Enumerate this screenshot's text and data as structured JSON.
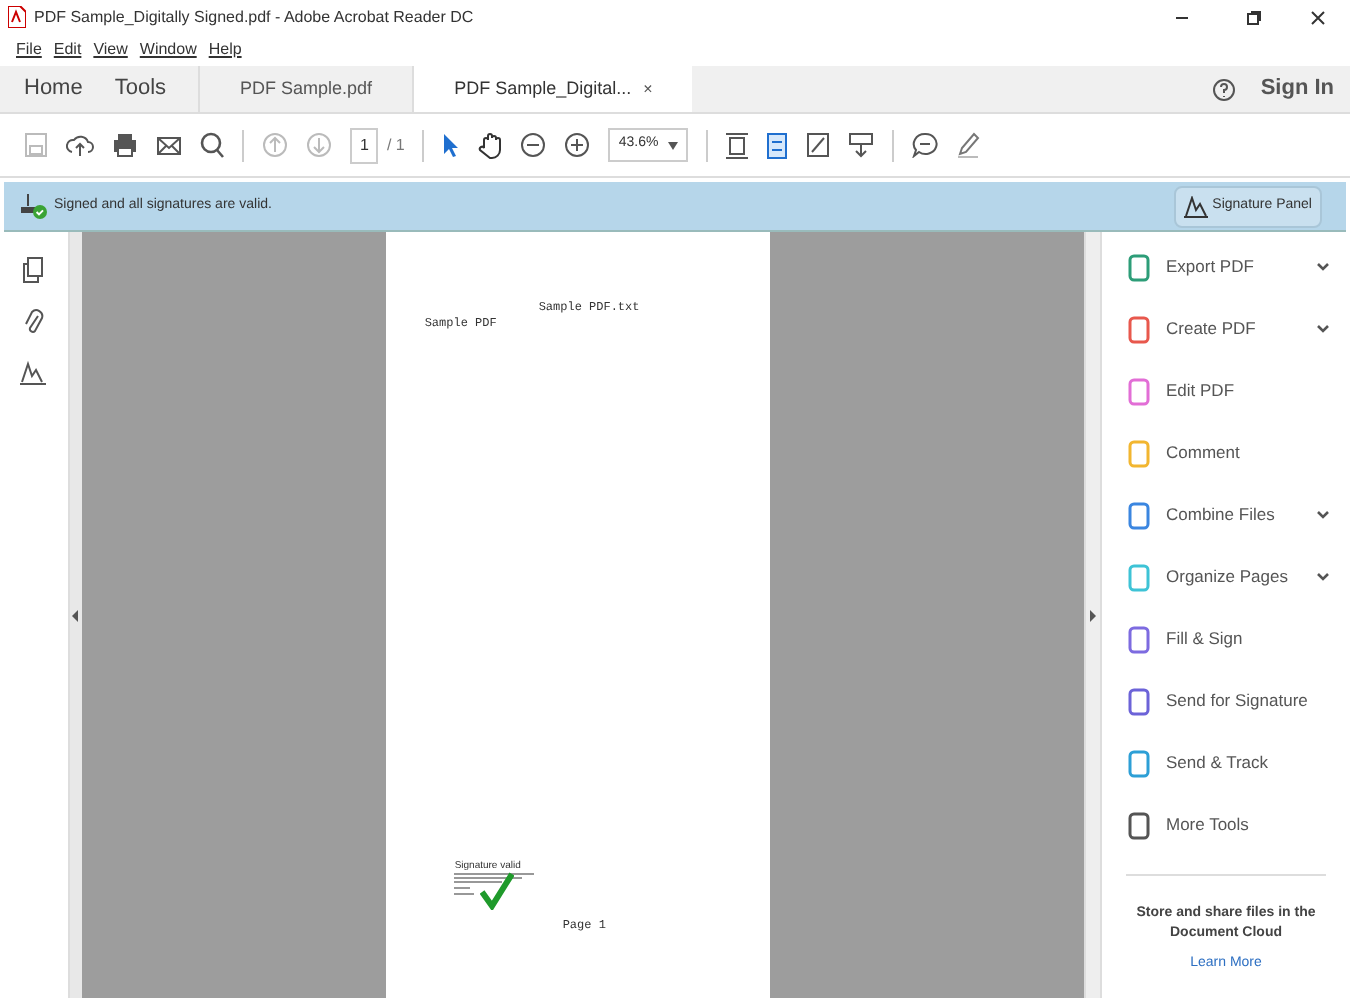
{
  "window": {
    "title": "PDF Sample_Digitally Signed.pdf - Adobe Acrobat Reader DC"
  },
  "menu": [
    "File",
    "Edit",
    "View",
    "Window",
    "Help"
  ],
  "nav": [
    {
      "label": "Home"
    },
    {
      "label": "Tools"
    }
  ],
  "tabs": [
    {
      "label": "PDF Sample.pdf",
      "selected": false
    },
    {
      "label": "PDF Sample_Digital...",
      "selected": true,
      "close": "×"
    }
  ],
  "sign_in": "Sign In",
  "toolbar": {
    "page": "1",
    "page_count": "/ 1",
    "zoom": "43.6%"
  },
  "banner": {
    "text": "Signed and all signatures are valid.",
    "button": "Signature Panel"
  },
  "document": {
    "header": "Sample PDF.txt",
    "title": "Sample PDF",
    "signature": "Signature valid",
    "footer": "Page 1"
  },
  "tools": [
    {
      "label": "Export PDF",
      "expandable": true,
      "color": "#2d9d78"
    },
    {
      "label": "Create PDF",
      "expandable": true,
      "color": "#e8584d"
    },
    {
      "label": "Edit PDF",
      "expandable": false,
      "color": "#e26ed6"
    },
    {
      "label": "Comment",
      "expandable": false,
      "color": "#f2b630"
    },
    {
      "label": "Combine Files",
      "expandable": true,
      "color": "#3b86e0"
    },
    {
      "label": "Organize Pages",
      "expandable": true,
      "color": "#3ec3d6"
    },
    {
      "label": "Fill & Sign",
      "expandable": false,
      "color": "#7d6be0"
    },
    {
      "label": "Send for Signature",
      "expandable": false,
      "color": "#6c63d8"
    },
    {
      "label": "Send & Track",
      "expandable": false,
      "color": "#2d9fd6"
    },
    {
      "label": "More Tools",
      "expandable": false,
      "color": "#555555"
    }
  ],
  "cloud": {
    "text": "Store and share files in the Document Cloud",
    "link": "Learn More"
  }
}
